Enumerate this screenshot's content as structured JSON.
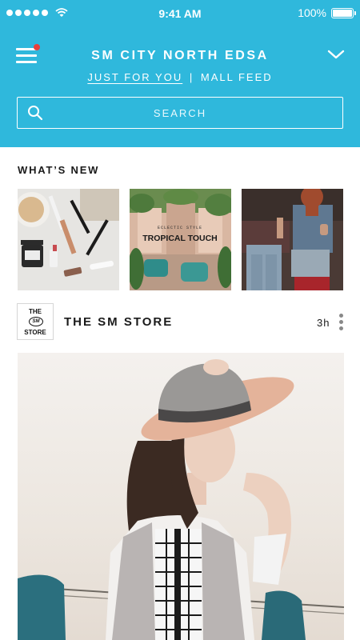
{
  "status_bar": {
    "time": "9:41 AM",
    "battery": "100%",
    "signal_icon": "signal-dots-icon",
    "wifi_icon": "wifi-icon",
    "battery_icon": "battery-icon"
  },
  "header": {
    "title": "SM CITY NORTH EDSA",
    "tabs": [
      {
        "label": "JUST FOR YOU",
        "active": true
      },
      {
        "label": "MALL FEED",
        "active": false
      }
    ],
    "tab_separator": "|",
    "menu_icon": "hamburger-menu-icon",
    "dropdown_icon": "chevron-down-icon",
    "accent_color": "#2fb8dc",
    "notification_color": "#e8403c"
  },
  "search": {
    "placeholder": "SEARCH",
    "icon": "search-icon"
  },
  "whats_new": {
    "title": "WHAT’S NEW",
    "items": [
      {
        "caption_small": "",
        "caption": "",
        "description_icon": "cosmetics-image"
      },
      {
        "caption_small": "ECLECTIC STYLE",
        "caption": "TROPICAL TOUCH",
        "description_icon": "tropical-interior-image"
      },
      {
        "caption_small": "",
        "caption": "",
        "description_icon": "denim-fashion-image"
      }
    ]
  },
  "post": {
    "store_name": "THE SM STORE",
    "time_ago": "3h",
    "logo": {
      "line1": "THE",
      "line2": "SM",
      "line3": "STORE"
    },
    "more_icon": "more-vertical-icon",
    "image_icon": "woman-in-hat-image"
  }
}
